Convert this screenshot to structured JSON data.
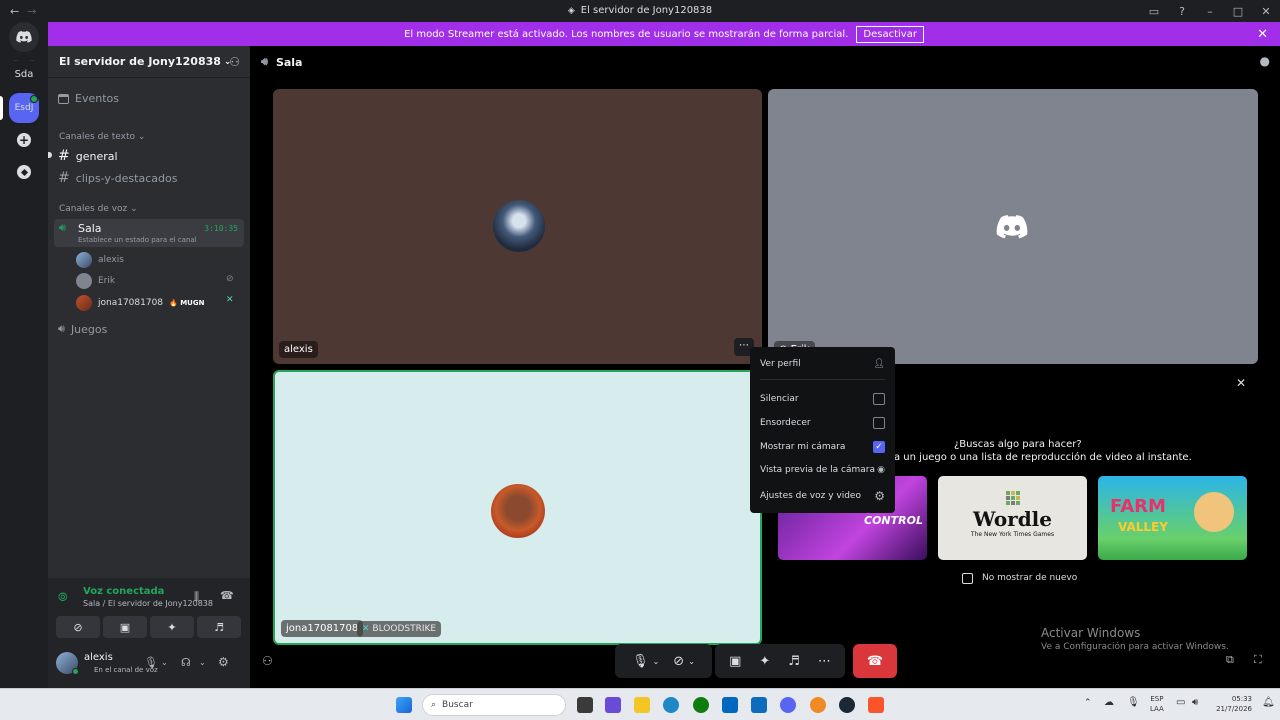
{
  "window": {
    "title": "El servidor de Jony120838"
  },
  "streamer_banner": {
    "text": "El modo Streamer está activado. Los nombres de usuario se mostrarán de forma parcial.",
    "button": "Desactivar"
  },
  "servers": [
    {
      "label": "Sda"
    },
    {
      "label": "EsdJ"
    }
  ],
  "guild": {
    "name": "El servidor de Jony120838"
  },
  "channels": {
    "events": "Eventos",
    "text_category": "Canales de texto",
    "text": [
      "general",
      "clips-y-destacados"
    ],
    "voice_category": "Canales de voz",
    "voice": {
      "name": "Sala",
      "timer": "3:10:35",
      "status": "Establece un estado para el canal",
      "users": [
        {
          "name": "alexis"
        },
        {
          "name": "Erik"
        },
        {
          "name": "jona17081708",
          "badge": "MUGN"
        }
      ]
    },
    "voice2": "Juegos"
  },
  "voice_panel": {
    "status": "Voz conectada",
    "location": "Sala / El servidor de Jony120838"
  },
  "user": {
    "name": "alexis",
    "status": "En el canal de voz"
  },
  "main": {
    "header": "Sala",
    "tiles": [
      {
        "label": "alexis"
      },
      {
        "label": "Erik"
      },
      {
        "label": "jona17081708",
        "game": "BLOODSTRIKE"
      }
    ]
  },
  "context_menu": {
    "items": [
      {
        "label": "Ver perfil",
        "icon": "user-icon"
      },
      {
        "label": "Silenciar",
        "checked": false
      },
      {
        "label": "Ensordecer",
        "checked": false
      },
      {
        "label": "Mostrar mi cámara",
        "checked": true
      },
      {
        "label": "Vista previa de la cámara",
        "icon": "eye-icon"
      },
      {
        "label": "Ajustes de voz y video",
        "icon": "gear-icon"
      }
    ]
  },
  "activity": {
    "title": "¿Buscas algo para hacer?",
    "subtitle": "a un juego o una lista de reproducción de video al instante.",
    "cards": [
      "CONTROL",
      "Wordle",
      "The New York Times Games",
      "FARM",
      "VALLEY"
    ],
    "dont_show": "No mostrar de nuevo"
  },
  "watermark": {
    "line1": "Activar Windows",
    "line2": "Ve a Configuración para activar Windows."
  },
  "taskbar": {
    "search": "Buscar",
    "lang1": "ESP",
    "lang2": "LAA",
    "time": "05:33",
    "date": "21/7/2026"
  },
  "colors": {
    "streamer": "#a12ee8",
    "green": "#23a55a",
    "red": "#da373c",
    "blurple": "#5865f2"
  }
}
